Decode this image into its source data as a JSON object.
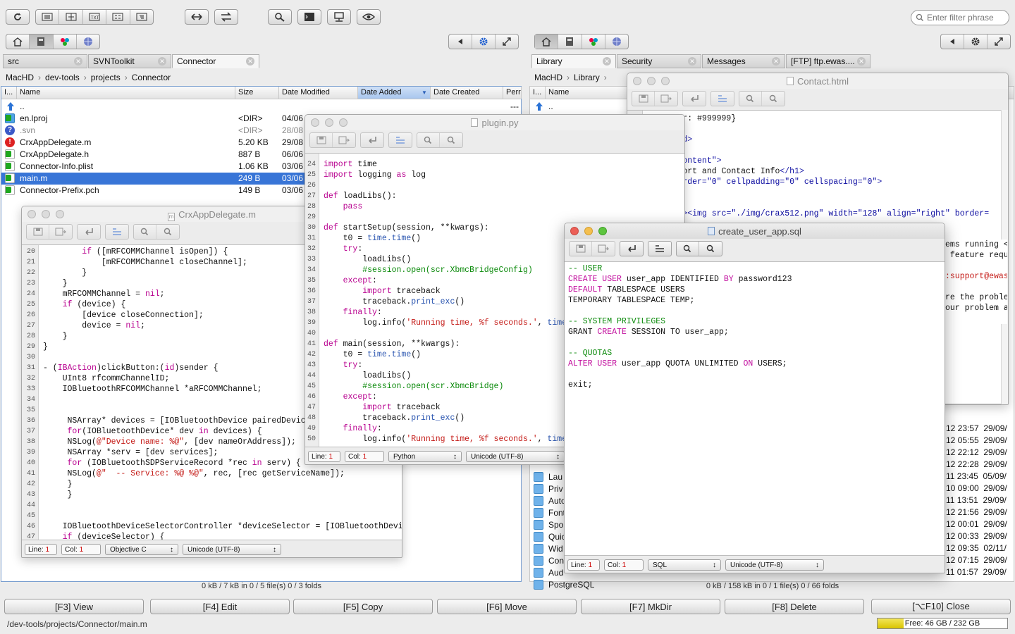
{
  "toolbar": {
    "filter_placeholder": "Enter filter phrase"
  },
  "left": {
    "tabs": [
      {
        "label": "src"
      },
      {
        "label": "SVNToolkit"
      },
      {
        "label": "Connector"
      }
    ],
    "breadcrumb": [
      "MacHD",
      "dev-tools",
      "projects",
      "Connector"
    ],
    "columns": [
      "I...",
      "Name",
      "Size",
      "Date Modified",
      "Date Added",
      "Date Created",
      "Perr"
    ],
    "files": [
      {
        "name": "..",
        "size": "",
        "date": "---",
        "icon": "up-arrow-icon"
      },
      {
        "name": "en.lproj",
        "size": "<DIR>",
        "date": "04/06",
        "icon": "folder-icon"
      },
      {
        "name": ".svn",
        "size": "<DIR>",
        "date": "28/08",
        "icon": "svn-folder-icon"
      },
      {
        "name": "CrxAppDelegate.m",
        "size": "5.20 KB",
        "date": "29/08",
        "icon": "conflict-file-icon"
      },
      {
        "name": "CrxAppDelegate.h",
        "size": "887 B",
        "date": "06/06",
        "icon": "file-icon"
      },
      {
        "name": "Connector-Info.plist",
        "size": "1.06 KB",
        "date": "03/06",
        "icon": "file-icon"
      },
      {
        "name": "main.m",
        "size": "249 B",
        "date": "03/06",
        "icon": "file-icon"
      },
      {
        "name": "Connector-Prefix.pch",
        "size": "149 B",
        "date": "03/06",
        "icon": "file-icon"
      }
    ],
    "status": "0 kB / 7 kB in 0 / 5 file(s) 0 / 3 folds"
  },
  "right": {
    "tabs": [
      {
        "label": "Library"
      },
      {
        "label": "Security"
      },
      {
        "label": "Messages"
      },
      {
        "label": "[FTP] ftp.ewas...."
      }
    ],
    "breadcrumb": [
      "MacHD",
      "Library"
    ],
    "columns": [
      "I...",
      "Name"
    ],
    "up_row": "..",
    "partial_names": [
      "Lau",
      "Priv",
      "Auto",
      "Font",
      "Spo",
      "Quic",
      "Wid",
      "Con",
      "Aud",
      "PostgreSQL"
    ],
    "dates": [
      "12 23:57  29/09/",
      "12 05:55  29/09/",
      "12 22:12  29/09/",
      "12 22:28  29/09/",
      "11 23:45  05/09/",
      "10 09:00  29/09/",
      "11 13:51  29/09/",
      "12 21:56  29/09/",
      "12 00:01  29/09/",
      "12 00:33  29/09/",
      "12 09:35  02/11/",
      "12 07:15  29/09/",
      "11 01:57  29/09/"
    ],
    "status": "0 kB / 158 kB in 0 / 1 file(s) 0 / 66 folds"
  },
  "fkeys": [
    "[F3] View",
    "[F4] Edit",
    "[F5] Copy",
    "[F6] Move",
    "[F7] MkDir",
    "[F8] Delete",
    "[⌥F10] Close"
  ],
  "path": "/dev-tools/projects/Connector/main.m",
  "free_space": {
    "label": "Free: 46 GB / 232 GB",
    "used_fraction": 0.2
  },
  "windows": {
    "crx": {
      "title": "CrxAppDelegate.m",
      "line_label": "Line:",
      "line_value": "1",
      "col_label": "Col:",
      "col_value": "1",
      "language": "Objective C",
      "encoding": "Unicode (UTF-8)",
      "lines": [
        {
          "n": "20",
          "html": "        <span class=\"kw\">if</span> ([mRFCOMMChannel isOpen]) {"
        },
        {
          "n": "21",
          "html": "            [mRFCOMMChannel closeChannel];"
        },
        {
          "n": "22",
          "html": "        }"
        },
        {
          "n": "23",
          "html": "    }"
        },
        {
          "n": "24",
          "html": "    mRFCOMMChannel = <span class=\"kw\">nil</span>;"
        },
        {
          "n": "25",
          "html": "    <span class=\"kw\">if</span> (device) {"
        },
        {
          "n": "26",
          "html": "        [device closeConnection];"
        },
        {
          "n": "27",
          "html": "        device = <span class=\"kw\">nil</span>;"
        },
        {
          "n": "28",
          "html": "    }"
        },
        {
          "n": "29",
          "html": "}"
        },
        {
          "n": "30",
          "html": ""
        },
        {
          "n": "31",
          "html": "- (<span class=\"kw\">IBAction</span>)clickButton:(<span class=\"kw\">id</span>)sender {"
        },
        {
          "n": "32",
          "html": "    UInt8 rfcommChannelID;"
        },
        {
          "n": "33",
          "html": "    IOBluetoothRFCOMMChannel *aRFCOMMChannel;"
        },
        {
          "n": "34",
          "html": ""
        },
        {
          "n": "35",
          "html": ""
        },
        {
          "n": "36",
          "html": "     NSArray* devices = [IOBluetoothDevice pairedDevices"
        },
        {
          "n": "37",
          "html": "     <span class=\"kw\">for</span>(IOBluetoothDevice* dev <span class=\"kw\">in</span> devices) {"
        },
        {
          "n": "38",
          "html": "     NSLog(<span class=\"str\">@\"Device name: %@\"</span>, [dev nameOrAddress]);"
        },
        {
          "n": "39",
          "html": "     NSArray *serv = [dev services];"
        },
        {
          "n": "40",
          "html": "     <span class=\"kw\">for</span> (IOBluetoothSDPServiceRecord *rec <span class=\"kw\">in</span> serv) {"
        },
        {
          "n": "41",
          "html": "     NSLog(<span class=\"str\">@\"  -- Service: %@ %@\"</span>, rec, [rec getServiceName]);"
        },
        {
          "n": "42",
          "html": "     }"
        },
        {
          "n": "43",
          "html": "     }"
        },
        {
          "n": "44",
          "html": ""
        },
        {
          "n": "45",
          "html": ""
        },
        {
          "n": "46",
          "html": "    IOBluetoothDeviceSelectorController *deviceSelector = [IOBluetoothDeviceS"
        },
        {
          "n": "47",
          "html": "    <span class=\"kw\">if</span> (deviceSelector) {"
        }
      ]
    },
    "plugin": {
      "title": "plugin.py",
      "line_label": "Line:",
      "line_value": "1",
      "col_label": "Col:",
      "col_value": "1",
      "language": "Python",
      "encoding": "Unicode (UTF-8)",
      "lines": [
        {
          "n": "24",
          "html": "<span class=\"kw\">import</span> time"
        },
        {
          "n": "25",
          "html": "<span class=\"kw\">import</span> logging <span class=\"kw\">as</span> log"
        },
        {
          "n": "26",
          "html": ""
        },
        {
          "n": "27",
          "html": "<span class=\"kw\">def</span> loadLibs():"
        },
        {
          "n": "28",
          "html": "    <span class=\"kw\">pass</span>"
        },
        {
          "n": "29",
          "html": ""
        },
        {
          "n": "30",
          "html": "<span class=\"kw\">def</span> startSetup(session, **kwargs):"
        },
        {
          "n": "31",
          "html": "    t0 = <span class=\"fn\">time.time</span>()"
        },
        {
          "n": "32",
          "html": "    <span class=\"kw\">try</span>:"
        },
        {
          "n": "33",
          "html": "        loadLibs()"
        },
        {
          "n": "34",
          "html": "        <span class=\"cm\">#session.open(scr.XbmcBridgeConfig)</span>"
        },
        {
          "n": "35",
          "html": "    <span class=\"kw\">except</span>:"
        },
        {
          "n": "36",
          "html": "        <span class=\"kw\">import</span> traceback"
        },
        {
          "n": "37",
          "html": "        traceback.<span class=\"fn\">print_exc</span>()"
        },
        {
          "n": "38",
          "html": "    <span class=\"kw\">finally</span>:"
        },
        {
          "n": "39",
          "html": "        log.info(<span class=\"str\">'Running time, %f seconds.'</span>, <span class=\"fn\">time.t</span>"
        },
        {
          "n": "40",
          "html": ""
        },
        {
          "n": "41",
          "html": "<span class=\"kw\">def</span> main(session, **kwargs):"
        },
        {
          "n": "42",
          "html": "    t0 = <span class=\"fn\">time.time</span>()"
        },
        {
          "n": "43",
          "html": "    <span class=\"kw\">try</span>:"
        },
        {
          "n": "44",
          "html": "        loadLibs()"
        },
        {
          "n": "45",
          "html": "        <span class=\"cm\">#session.open(scr.XbmcBridge)</span>"
        },
        {
          "n": "46",
          "html": "    <span class=\"kw\">except</span>:"
        },
        {
          "n": "47",
          "html": "        <span class=\"kw\">import</span> traceback"
        },
        {
          "n": "48",
          "html": "        traceback.<span class=\"fn\">print_exc</span>()"
        },
        {
          "n": "49",
          "html": "    <span class=\"kw\">finally</span>:"
        },
        {
          "n": "50",
          "html": "        log.info(<span class=\"str\">'Running time, %f seconds.'</span>, <span class=\"fn\">time.t</span>"
        }
      ]
    },
    "contact": {
      "title": "Contact.html",
      "lines": [
        {
          "html": "  {color: #999999}"
        },
        {
          "html": ""
        },
        {
          "html": "  <span class=\"tag\">&lt;/head&gt;</span>"
        },
        {
          "html": ""
        },
        {
          "html": "  <span class=\"attr\">id=\"content\"</span><span class=\"tag\">&gt;</span>"
        },
        {
          "html": "<span class=\"tag\">h1&gt;</span>Support and Contact Info<span class=\"tag\">&lt;/h1&gt;</span>"
        },
        {
          "html": "<span class=\"tag\">able</span> <span class=\"attr\">border=\"0\" cellpadding=\"0\" cellspacing=\"0\"</span><span class=\"tag\">&gt;</span>"
        },
        {
          "html": "<span class=\"tag\">&lt;tbody&gt;</span>"
        },
        {
          "html": "  <span class=\"tag\">&lt;tr&gt;</span>"
        },
        {
          "html": "    <span class=\"tag\">&lt;td&gt;&lt;img</span> <span class=\"attr\">src=\"./img/crax512.png\" width=\"128\" align=\"right\" border=</span>"
        }
      ],
      "right_fragments": [
        {
          "html": "ems running &lt;s"
        },
        {
          "html": " feature reque"
        },
        {
          "html": ""
        },
        {
          "html": "<span class=\"str\">:support@ewas</span>"
        },
        {
          "html": ""
        },
        {
          "html": "re the problem"
        },
        {
          "html": "our problem as"
        }
      ]
    },
    "sql": {
      "title": "create_user_app.sql",
      "line_label": "Line:",
      "line_value": "1",
      "col_label": "Col:",
      "col_value": "1",
      "language": "SQL",
      "encoding": "Unicode (UTF-8)",
      "lines": [
        {
          "html": "<span class=\"cm\">-- USER</span>"
        },
        {
          "html": "<span class=\"sqlkw\">CREATE USER</span> user_app IDENTIFIED <span class=\"sqlkw\">BY</span> password123"
        },
        {
          "html": "<span class=\"sqlkw\">DEFAULT</span> TABLESPACE USERS"
        },
        {
          "html": "TEMPORARY TABLESPACE TEMP;"
        },
        {
          "html": ""
        },
        {
          "html": "<span class=\"cm\">-- SYSTEM PRIVILEGES</span>"
        },
        {
          "html": "GRANT <span class=\"sqlkw\">CREATE</span> SESSION TO user_app;"
        },
        {
          "html": ""
        },
        {
          "html": "<span class=\"cm\">-- QUOTAS</span>"
        },
        {
          "html": "<span class=\"sqlkw\">ALTER USER</span> user_app QUOTA UNLIMITED <span class=\"sqlkw\">ON</span> USERS;"
        },
        {
          "html": ""
        },
        {
          "html": "exit;"
        }
      ]
    }
  }
}
